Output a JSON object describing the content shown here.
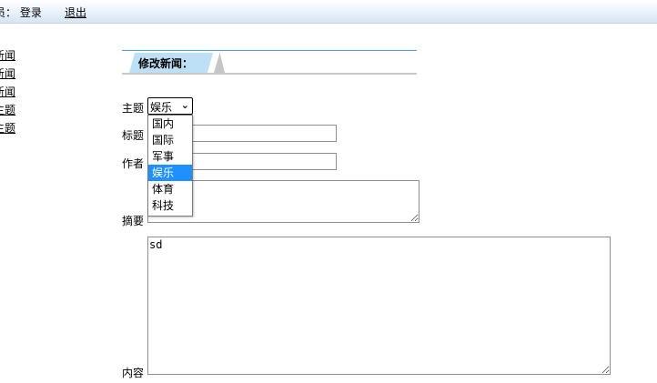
{
  "header": {
    "user_text": "员： 登录",
    "logout_label": "退出"
  },
  "sidebar": {
    "items": [
      {
        "label": "新闻"
      },
      {
        "label": "新闻"
      },
      {
        "label": "新闻"
      },
      {
        "label": "主题"
      },
      {
        "label": "主题"
      }
    ]
  },
  "section": {
    "title": "修改新闻："
  },
  "form": {
    "topic_label": "主题",
    "topic_selected": "娱乐",
    "topic_options": [
      "国内",
      "国际",
      "军事",
      "娱乐",
      "体育",
      "科技"
    ],
    "title_label": "标题",
    "author_label": "作者",
    "summary_label": "摘要",
    "content_label": "内容",
    "content_value": "sd"
  }
}
